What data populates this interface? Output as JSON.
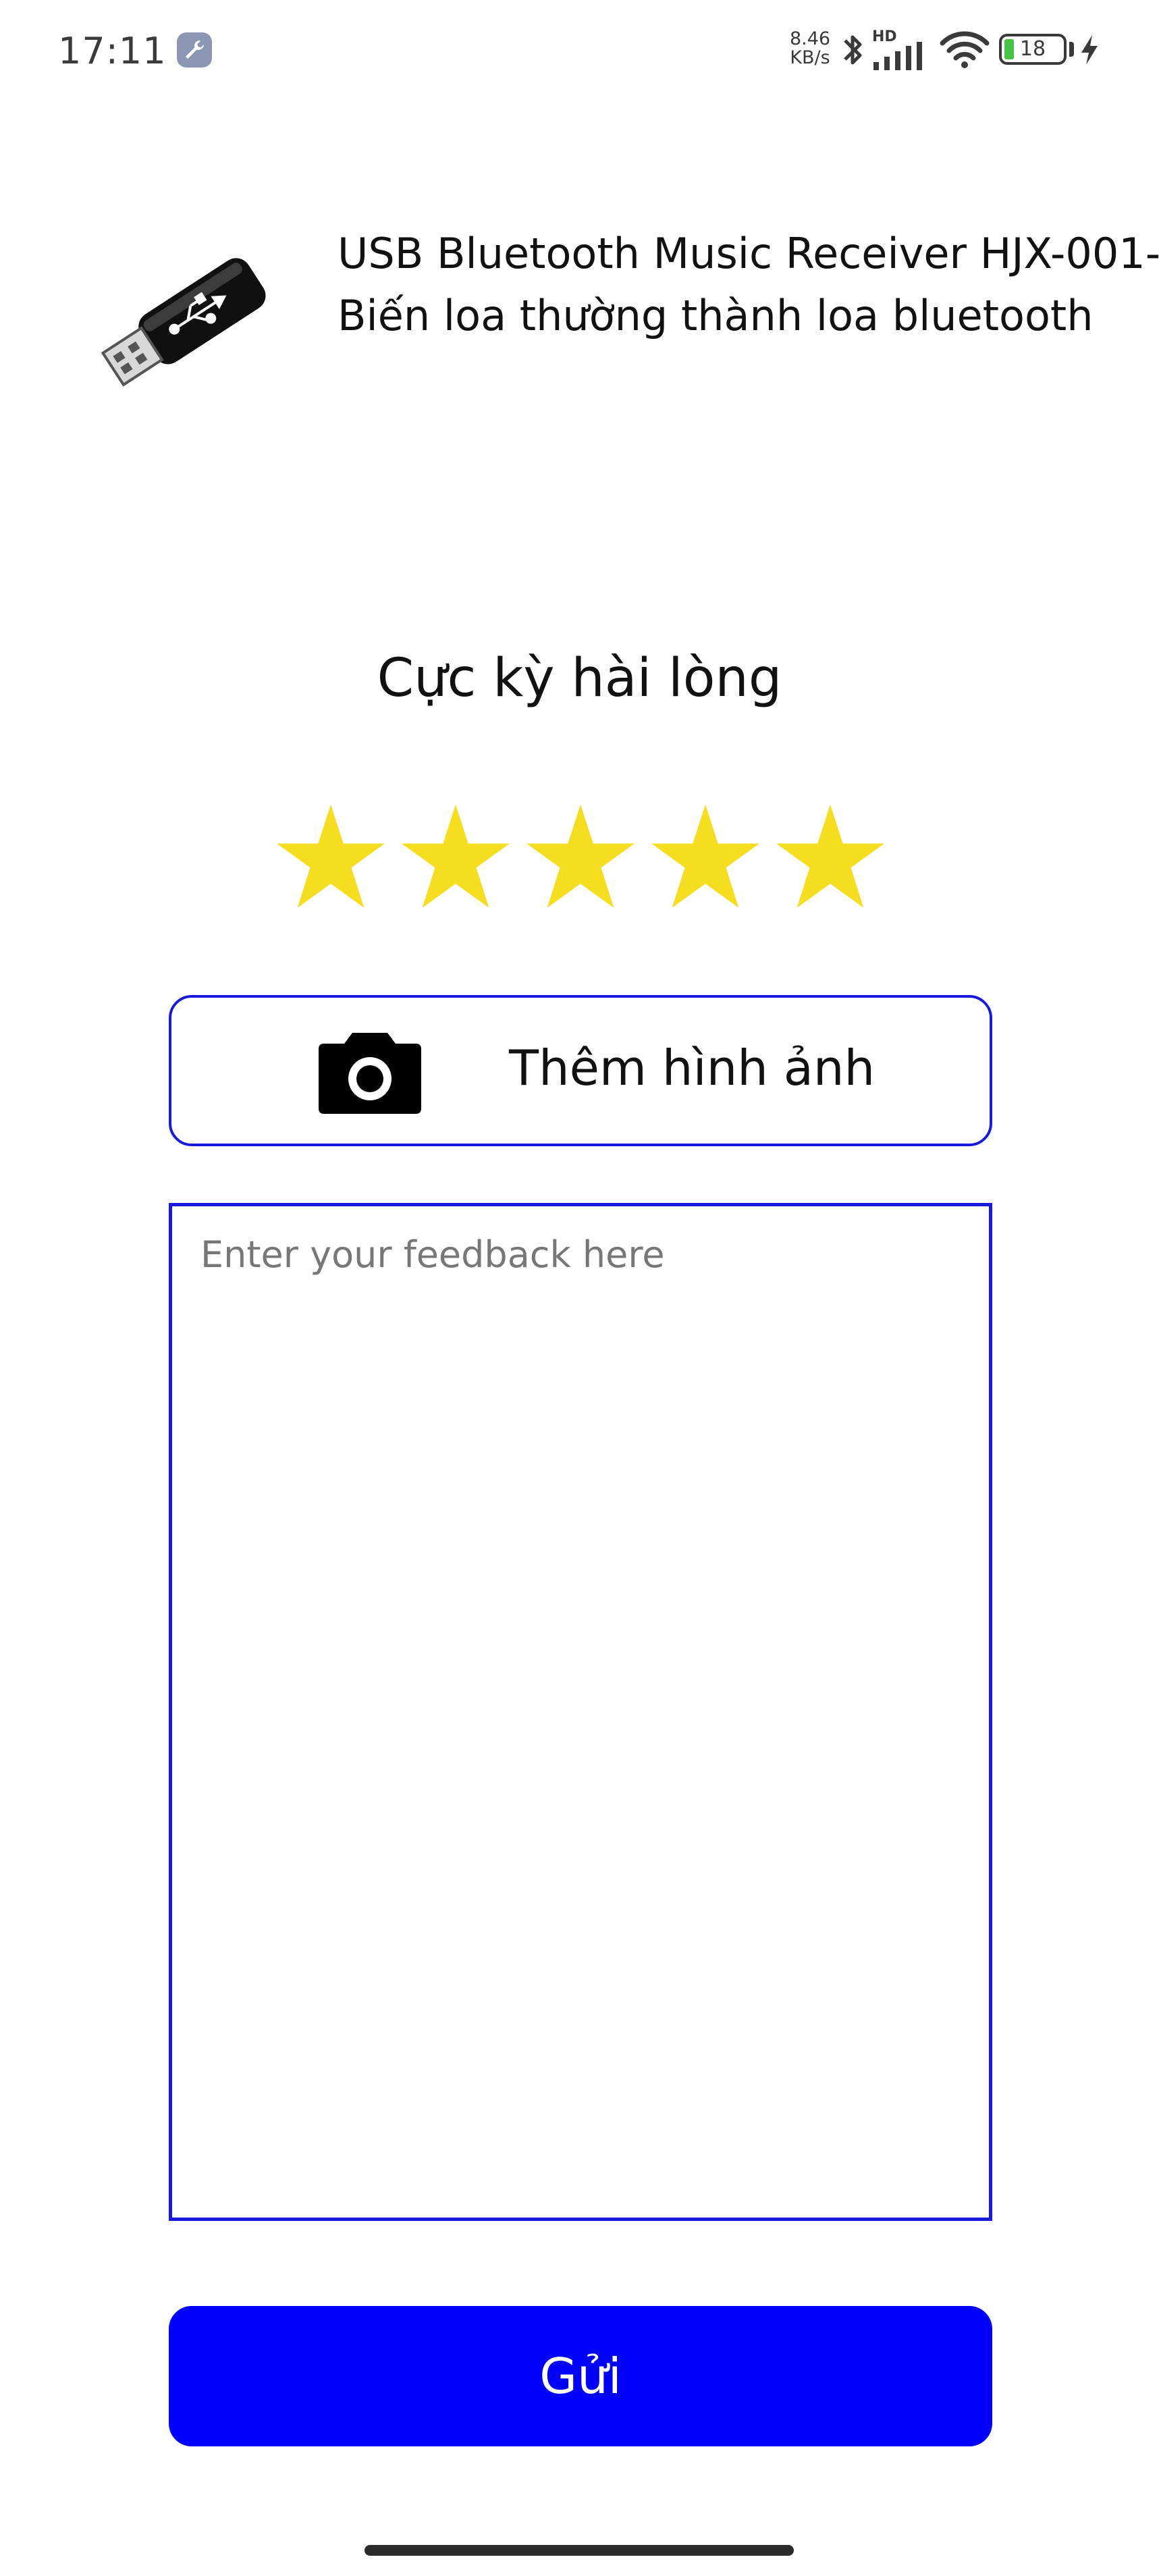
{
  "status_bar": {
    "time": "17:11",
    "net_speed_value": "8.46",
    "net_speed_unit": "KB/s",
    "network_label": "HD",
    "battery_level": "18",
    "icons": [
      "wrench-icon",
      "bluetooth-icon",
      "signal-icon",
      "wifi-icon",
      "battery-icon",
      "charging-icon"
    ]
  },
  "product": {
    "title": "USB Bluetooth Music Receiver HJX-001- Biến loa thường thành loa bluetooth",
    "image_icon": "usb-dongle-icon"
  },
  "rating": {
    "label": "Cực kỳ hài lòng",
    "value": 5,
    "max": 5,
    "star_color": "#f5dd1f"
  },
  "add_photo": {
    "label": "Thêm hình ảnh",
    "icon": "camera-icon"
  },
  "feedback": {
    "placeholder": "Enter your feedback here",
    "value": ""
  },
  "submit": {
    "label": "Gửi",
    "color": "#0000ff"
  },
  "colors": {
    "accent_border": "#1a1adf",
    "primary_button": "#0000ff"
  }
}
